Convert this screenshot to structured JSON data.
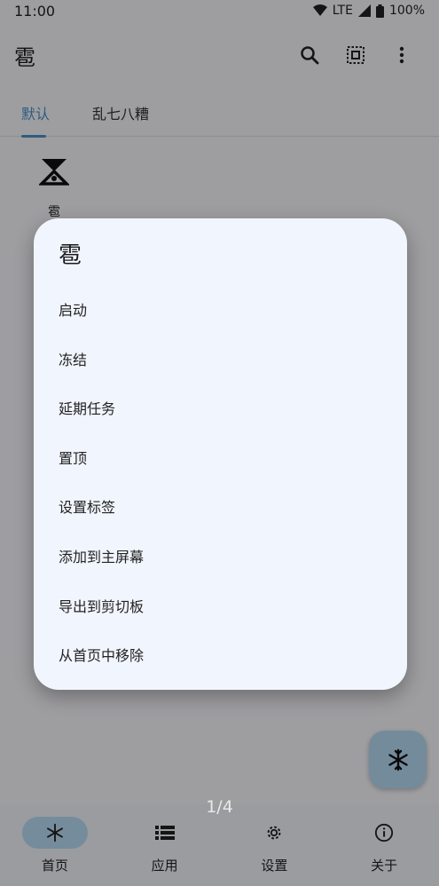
{
  "status_bar": {
    "time": "11:00",
    "network": "LTE",
    "battery": "100%"
  },
  "app_bar": {
    "title": "雹"
  },
  "tabs": [
    {
      "label": "默认",
      "active": true
    },
    {
      "label": "乱七八糟",
      "active": false
    }
  ],
  "app_tile": {
    "label": "雹"
  },
  "dialog": {
    "title": "雹",
    "items": [
      "启动",
      "冻结",
      "延期任务",
      "置顶",
      "设置标签",
      "添加到主屏幕",
      "导出到剪切板",
      "从首页中移除"
    ]
  },
  "page_indicator": "1/4",
  "bottom_nav": [
    {
      "label": "首页",
      "icon": "snowflake-icon",
      "active": true
    },
    {
      "label": "应用",
      "icon": "list-icon",
      "active": false
    },
    {
      "label": "设置",
      "icon": "gear-icon",
      "active": false
    },
    {
      "label": "关于",
      "icon": "info-icon",
      "active": false
    }
  ],
  "colors": {
    "accent": "#4a90c6",
    "fab_bg": "#b6d9f2",
    "dialog_bg": "#f1f5fd",
    "scrim": "#5a5a5a"
  }
}
